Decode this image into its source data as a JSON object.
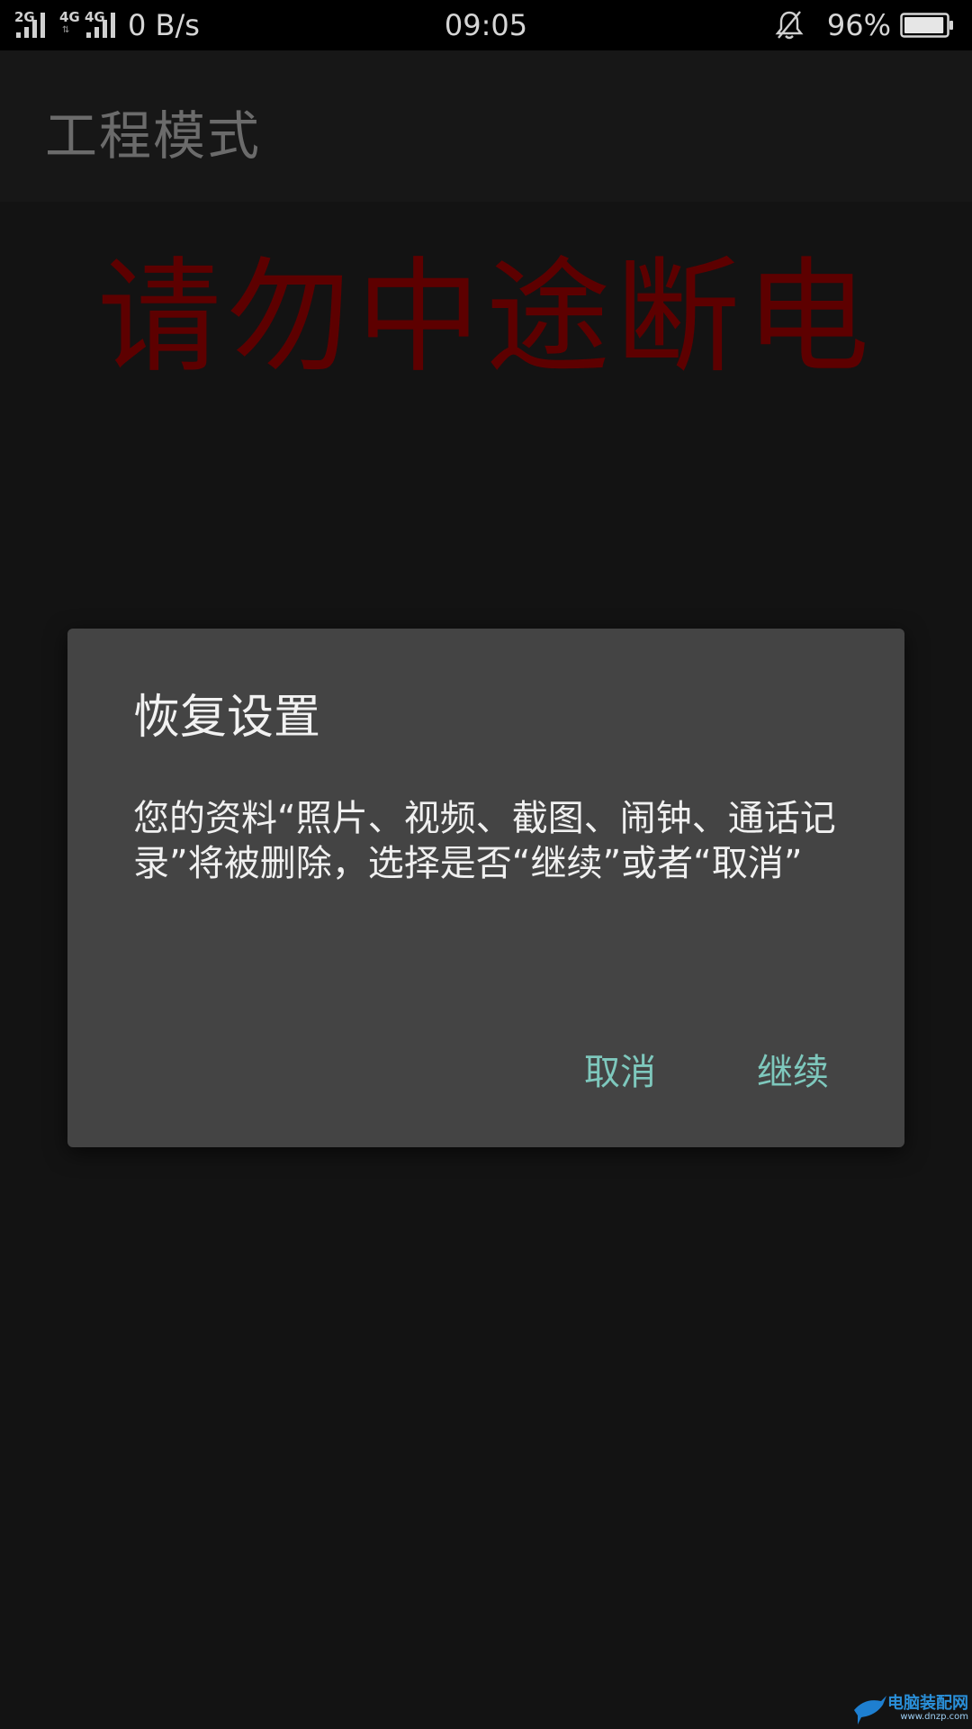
{
  "status_bar": {
    "sim1_label": "2G",
    "sim2_label": "4G",
    "sim3_label": "4G",
    "net_speed": "0 B/s",
    "time": "09:05",
    "battery_percent": "96%",
    "battery_level": 0.96,
    "icons": [
      "signal-icon",
      "data-arrows-icon",
      "bell-muted-icon",
      "battery-icon"
    ]
  },
  "app_bar": {
    "title": "工程模式"
  },
  "warning": {
    "text": "请勿中途断电",
    "color": "#5d0000"
  },
  "dialog": {
    "title": "恢复设置",
    "message": "您的资料“照片、视频、截图、闹钟、通话记录”将被删除，选择是否“继续”或者“取消”",
    "cancel_label": "取消",
    "continue_label": "继续",
    "button_color": "#7ec8bd"
  },
  "watermark": {
    "text": "电脑装配网",
    "url": "www.dnzp.com"
  }
}
